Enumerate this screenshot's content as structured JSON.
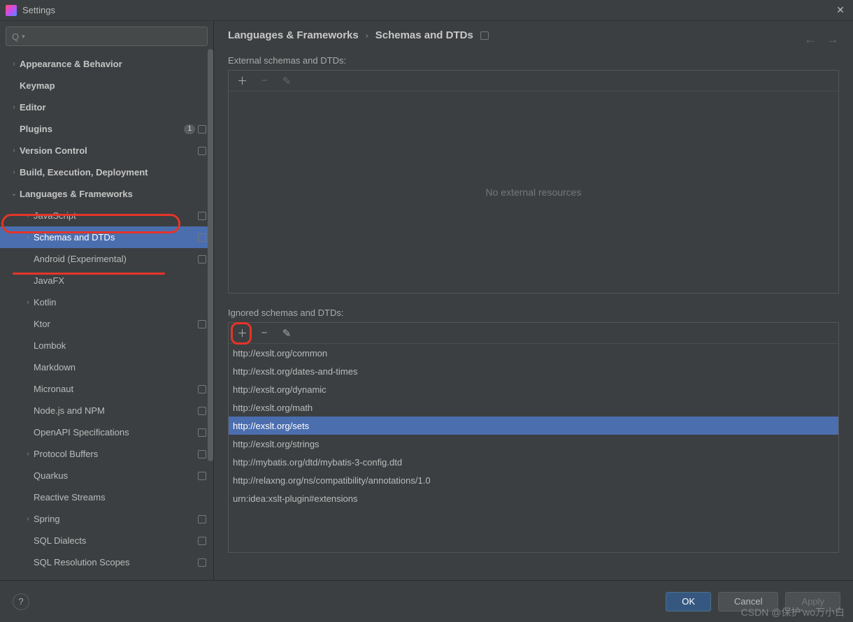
{
  "window": {
    "title": "Settings"
  },
  "breadcrumb": {
    "parent": "Languages & Frameworks",
    "current": "Schemas and DTDs"
  },
  "sidebar": {
    "items": [
      {
        "label": "Appearance & Behavior",
        "bold": true,
        "arrow": "right",
        "indent": 0
      },
      {
        "label": "Keymap",
        "bold": true,
        "arrow": "",
        "indent": 0
      },
      {
        "label": "Editor",
        "bold": true,
        "arrow": "right",
        "indent": 0
      },
      {
        "label": "Plugins",
        "bold": true,
        "arrow": "",
        "indent": 0,
        "count": "1",
        "proj": true
      },
      {
        "label": "Version Control",
        "bold": true,
        "arrow": "right",
        "indent": 0,
        "proj": true
      },
      {
        "label": "Build, Execution, Deployment",
        "bold": true,
        "arrow": "right",
        "indent": 0
      },
      {
        "label": "Languages & Frameworks",
        "bold": true,
        "arrow": "down",
        "indent": 0
      },
      {
        "label": "JavaScript",
        "arrow": "right",
        "indent": 1,
        "proj": true
      },
      {
        "label": "Schemas and DTDs",
        "arrow": "right",
        "indent": 1,
        "proj": true,
        "selected": true
      },
      {
        "label": "Android (Experimental)",
        "arrow": "",
        "indent": 1,
        "proj": true
      },
      {
        "label": "JavaFX",
        "arrow": "",
        "indent": 1
      },
      {
        "label": "Kotlin",
        "arrow": "right",
        "indent": 1
      },
      {
        "label": "Ktor",
        "arrow": "",
        "indent": 1,
        "proj": true
      },
      {
        "label": "Lombok",
        "arrow": "",
        "indent": 1
      },
      {
        "label": "Markdown",
        "arrow": "",
        "indent": 1
      },
      {
        "label": "Micronaut",
        "arrow": "",
        "indent": 1,
        "proj": true
      },
      {
        "label": "Node.js and NPM",
        "arrow": "",
        "indent": 1,
        "proj": true
      },
      {
        "label": "OpenAPI Specifications",
        "arrow": "",
        "indent": 1,
        "proj": true
      },
      {
        "label": "Protocol Buffers",
        "arrow": "right",
        "indent": 1,
        "proj": true
      },
      {
        "label": "Quarkus",
        "arrow": "",
        "indent": 1,
        "proj": true
      },
      {
        "label": "Reactive Streams",
        "arrow": "",
        "indent": 1
      },
      {
        "label": "Spring",
        "arrow": "right",
        "indent": 1,
        "proj": true
      },
      {
        "label": "SQL Dialects",
        "arrow": "",
        "indent": 1,
        "proj": true
      },
      {
        "label": "SQL Resolution Scopes",
        "arrow": "",
        "indent": 1,
        "proj": true
      }
    ]
  },
  "external": {
    "label": "External schemas and DTDs:",
    "empty_text": "No external resources"
  },
  "ignored": {
    "label": "Ignored schemas and DTDs:",
    "items": [
      "http://exslt.org/common",
      "http://exslt.org/dates-and-times",
      "http://exslt.org/dynamic",
      "http://exslt.org/math",
      "http://exslt.org/sets",
      "http://exslt.org/strings",
      "http://mybatis.org/dtd/mybatis-3-config.dtd",
      "http://relaxng.org/ns/compatibility/annotations/1.0",
      "urn:idea:xslt-plugin#extensions"
    ],
    "selected_index": 4
  },
  "footer": {
    "ok": "OK",
    "cancel": "Cancel",
    "apply": "Apply",
    "help": "?"
  },
  "watermark": "CSDN @保护'wo万小白"
}
